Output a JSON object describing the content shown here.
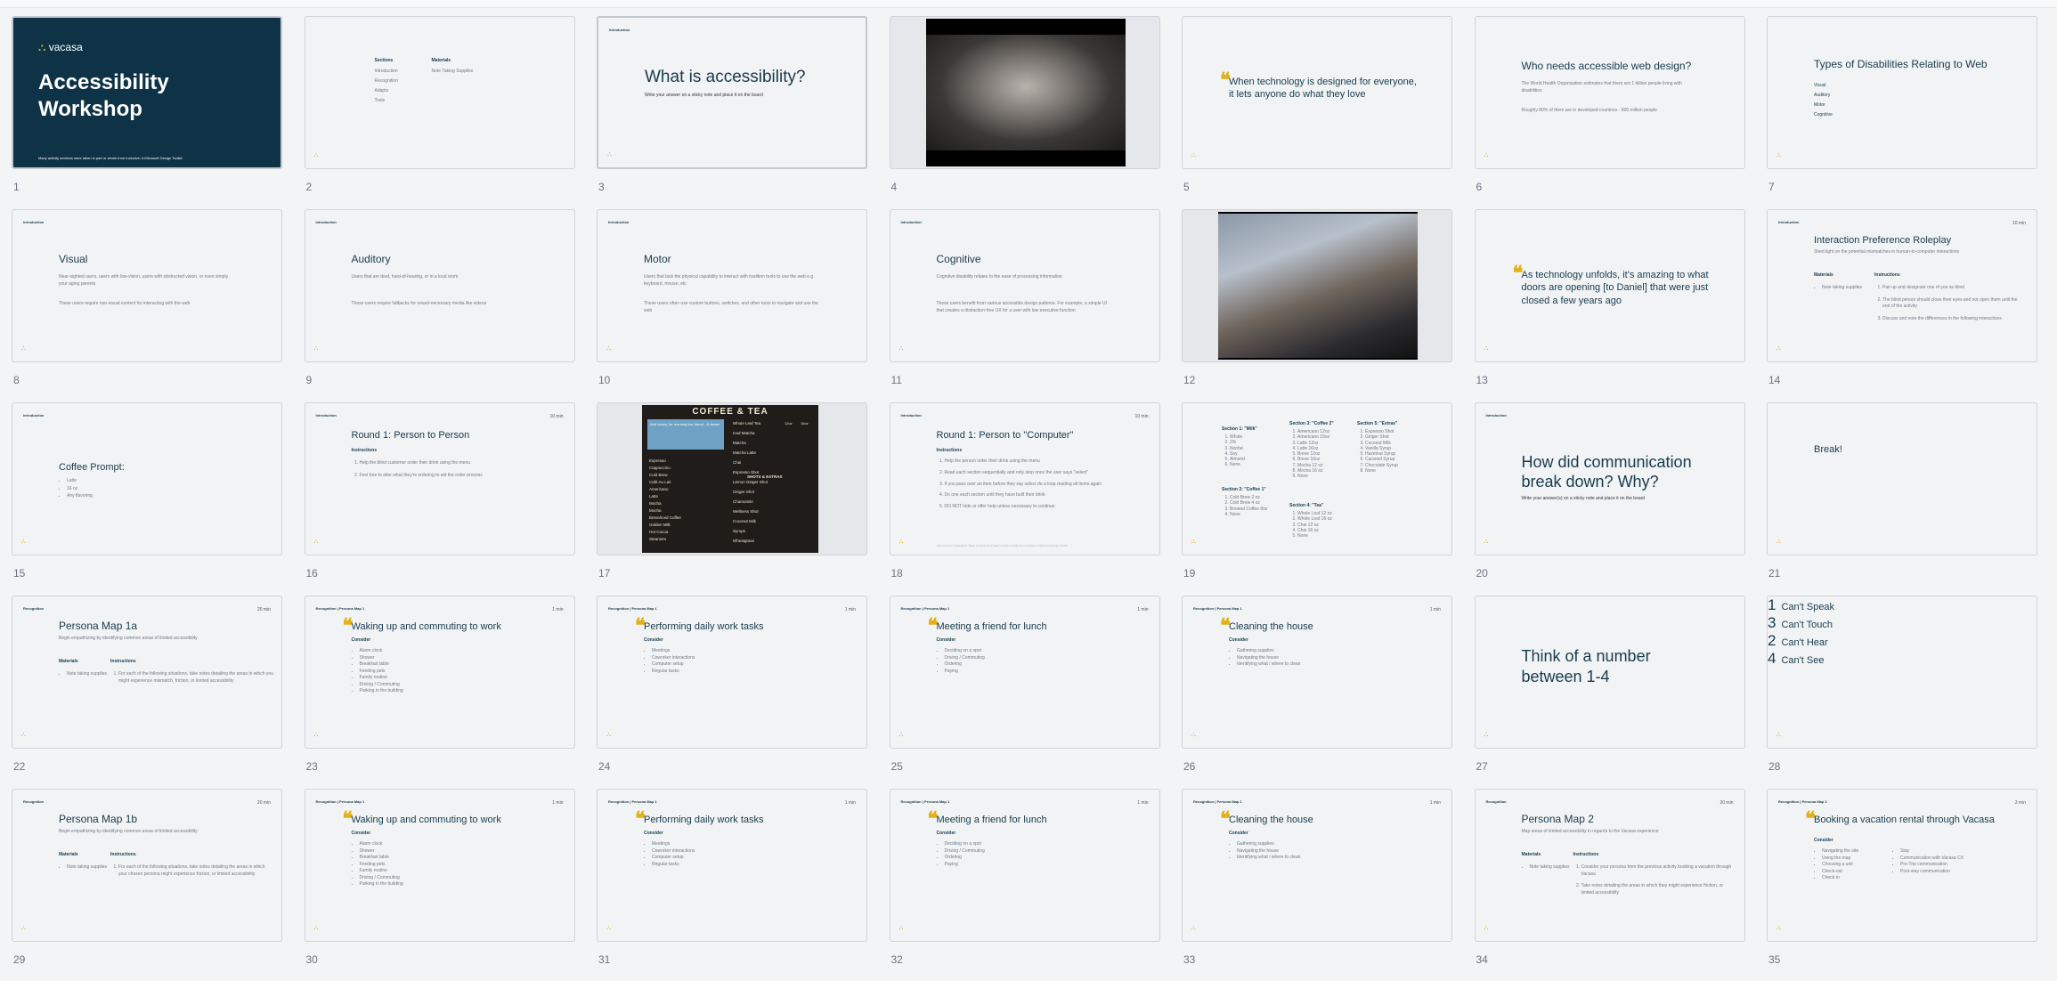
{
  "slides": [
    {
      "num": "1",
      "tag": "",
      "title": "",
      "kind": "cover",
      "brand": "vacasa",
      "cover_title": "Accessibility Workshop",
      "footer": "Many activity sections were taken in part or whole from Inclusive: A Microsoft Design Toolkit"
    },
    {
      "num": "2",
      "kind": "sections",
      "col1_title": "Sections",
      "col1": [
        "Introduction",
        "Recognition",
        "Adapts",
        "Tools"
      ],
      "col2_title": "Materials",
      "col2": [
        "Note Taking Supplies"
      ]
    },
    {
      "num": "3",
      "kind": "title-sub",
      "tag": "Introduction",
      "title": "What is accessibility?",
      "sub": "Write your answer on a sticky note and place it on the board"
    },
    {
      "num": "4",
      "kind": "video"
    },
    {
      "num": "5",
      "kind": "quote",
      "quote_text": "When technology is designed for everyone, it lets anyone do what they love"
    },
    {
      "num": "6",
      "kind": "text",
      "title": "Who needs accessible web design?",
      "lines": [
        "The World Health Organization estimates that there are 1 billion people living with disabilities",
        "Roughly 80% of them are in developed countries - 800 million people"
      ]
    },
    {
      "num": "7",
      "kind": "list-title",
      "title": "Types of Disabilities Relating to Web",
      "items": [
        "Visual",
        "Auditory",
        "Motor",
        "Cognitive"
      ]
    },
    {
      "num": "8",
      "kind": "text",
      "tag": "Introduction",
      "title": "Visual",
      "lines": [
        "Near-sighted users, users with low-vision, users with obstructed vision, or even simply your aging parents",
        "These users require non-visual content for interacting with the web"
      ]
    },
    {
      "num": "9",
      "kind": "text",
      "tag": "Introduction",
      "title": "Auditory",
      "lines": [
        "Users that are deaf, hard-of-hearing, or in a loud room",
        "These users require fallbacks for sound-necessary media like videos"
      ]
    },
    {
      "num": "10",
      "kind": "text",
      "tag": "Introduction",
      "title": "Motor",
      "lines": [
        "Users that lack the physical capability to interact with tradition tools to use the web e.g. keyboard, mouse, etc",
        "These users often use custom buttons, switches, and other tools to navigate and use the web"
      ]
    },
    {
      "num": "11",
      "kind": "text",
      "tag": "Introduction",
      "title": "Cognitive",
      "lines": [
        "Cognitive disability relates to the ease of processing information",
        "These users benefit from various accessible design patterns. For example, a simple UI that creates a distraction-free UX for a user with low executive function"
      ]
    },
    {
      "num": "12",
      "kind": "video"
    },
    {
      "num": "13",
      "kind": "quote",
      "quote_text": "As technology unfolds, it's amazing to what doors are opening [to Daniel] that were just closed a few years ago"
    },
    {
      "num": "14",
      "kind": "roleplay",
      "tag": "Introduction",
      "mins": "10 min",
      "title": "Interaction Preference Roleplay",
      "sub": "Shed light on the potential mismatches in human-to-computer interactions",
      "mat_title": "Materials",
      "mat": [
        "Note taking supplies"
      ],
      "ins_title": "Instructions",
      "ins": [
        "Pair up and designate one of you as blind",
        "The blind person should close their eyes and not open them until the end of the activity",
        "Discuss and note the differences in the following interactions"
      ]
    },
    {
      "num": "15",
      "kind": "coffee",
      "tag": "Introduction",
      "title": "Coffee Prompt:",
      "items": [
        "Latte",
        "16 oz",
        "Any flavoring"
      ]
    },
    {
      "num": "16",
      "kind": "round",
      "tag": "Introduction",
      "mins": "10 min",
      "title": "Round 1: Person to Person",
      "ins_title": "Instructions",
      "ins": [
        "Help the blind customer order their drink using the menu",
        "Feel free to alter what they're ordering to aid the order process"
      ]
    },
    {
      "num": "17",
      "kind": "menu",
      "menu_title": "COFFEE & TEA",
      "menu_left": [
        "Espresso",
        "Cappuccino",
        "Cold Brew",
        "Café Au Lait",
        "Americano",
        "Latte",
        "Mocha",
        "Mocha",
        "Breve/Iced Coffee",
        "Golden Milk",
        "Hot Cocoa",
        "Steamers"
      ],
      "menu_right": [
        "Whole Leaf Tea",
        "Iced Matcha",
        "Matcha",
        "Matcha Latte",
        "Chai",
        "Espresso Shot",
        "Lemon Ginger Shot",
        "Ginger Shot",
        "Chamomile",
        "Wellness Shot",
        "Coconut Milk",
        "Syrups",
        "Wheatgrass"
      ],
      "menu_headers": [
        "12oz",
        "16oz"
      ],
      "menu_section": "SHOTS & EXTRAS",
      "menu_note": "Add honey, for morning tea, blend - & steam"
    },
    {
      "num": "18",
      "kind": "round2",
      "tag": "Introduction",
      "mins": "10 min",
      "title": "Round 1: Person to \"Computer\"",
      "ins_title": "Instructions",
      "ins": [
        "Help the person order their drink using the menu",
        "Read each section sequentially and only stop once the user says \"select\"",
        "If you pass over an item before they say select do a loop reading all items again",
        "Do one each section until they have built their drink",
        "DO NOT hide or offer help unless necessary to continue"
      ],
      "footer": "This round for explanation: Many sections were taken in part or whole from Inclusive: A Microsoft Design Toolkit"
    },
    {
      "num": "19",
      "kind": "sections-menu",
      "s1_title": "Section 1: \"Milk\"",
      "s1": [
        "Whole",
        "2%",
        "Nonfat",
        "Soy",
        "Almond",
        "None"
      ],
      "s2_title": "Section 2: \"Coffee 1\"",
      "s2": [
        "Cold Brew 2 oz",
        "Cold Brew 4 oz",
        "Brewed Coffee 8oz",
        "None"
      ],
      "s3_title": "Section 3: \"Coffee 2\"",
      "s3": [
        "Americano 12oz",
        "Americano 16oz",
        "Latte 12oz",
        "Latte 16oz",
        "Breve 12oz",
        "Breve 16oz",
        "Mocha 12 oz",
        "Mocha 16 oz",
        "None"
      ],
      "s4_title": "Section 4: \"Tea\"",
      "s4": [
        "Whole Leaf 12 oz",
        "Whole Leaf 16 oz",
        "Chai 12 oz",
        "Chai 16 oz",
        "None"
      ],
      "s5_title": "Section 5: \"Extras\"",
      "s5": [
        "Espresso Shot",
        "Ginger Shot",
        "Coconut Milk",
        "Vanilla Syrup",
        "Hazelnut Syrup",
        "Caramel Syrup",
        "Chocolate Syrup",
        "None"
      ]
    },
    {
      "num": "20",
      "kind": "title-sub2",
      "tag": "Introduction",
      "title": "How did communication break down? Why?",
      "sub": "Write your answer(s) on a sticky note and place it on the board"
    },
    {
      "num": "21",
      "kind": "break",
      "title": "Break!"
    },
    {
      "num": "22",
      "kind": "persona",
      "tag": "Recognition",
      "mins": "20 min",
      "title": "Persona Map 1a",
      "sub": "Begin empathizing by identifying common areas of limited accessibility",
      "mat_title": "Materials",
      "mat": [
        "Note taking supplies"
      ],
      "ins_title": "Instructions",
      "ins": [
        "For each of the following situations, take notes detailing the areas in which you might experience mismatch, friction, or limited accessibility"
      ]
    },
    {
      "num": "23",
      "kind": "scenario",
      "tag": "Recognition | Persona Map 1",
      "mins": "1 min",
      "title": "Waking up and commuting to work",
      "consider": "Consider",
      "items": [
        "Alarm clock",
        "Shower",
        "Breakfast table",
        "Feeding pets",
        "Family routine",
        "Driving / Commuting",
        "Parking in the building"
      ]
    },
    {
      "num": "24",
      "kind": "scenario",
      "tag": "Recognition | Persona Map 1",
      "mins": "1 min",
      "title": "Performing daily work tasks",
      "consider": "Consider",
      "items": [
        "Meetings",
        "Coworker interactions",
        "Computer setup",
        "Regular tasks"
      ]
    },
    {
      "num": "25",
      "kind": "scenario",
      "tag": "Recognition | Persona Map 1",
      "mins": "1 min",
      "title": "Meeting a friend for lunch",
      "consider": "Consider",
      "items": [
        "Deciding on a spot",
        "Driving / Commuting",
        "Ordering",
        "Paying"
      ]
    },
    {
      "num": "26",
      "kind": "scenario",
      "tag": "Recognition | Persona Map 1",
      "mins": "1 min",
      "title": "Cleaning the house",
      "consider": "Consider",
      "items": [
        "Gathering supplies",
        "Navigating the house",
        "Identifying what / where to clean"
      ]
    },
    {
      "num": "27",
      "kind": "think",
      "title": "Think of a number between 1-4"
    },
    {
      "num": "28",
      "kind": "numbers",
      "items": [
        {
          "n": "1",
          "t": "Can't Speak"
        },
        {
          "n": "3",
          "t": "Can't Touch"
        },
        {
          "n": "2",
          "t": "Can't Hear"
        },
        {
          "n": "4",
          "t": "Can't See"
        }
      ]
    },
    {
      "num": "29",
      "kind": "persona",
      "tag": "Recognition",
      "mins": "20 min",
      "title": "Persona Map 1b",
      "sub": "Begin empathizing by identifying common areas of limited accessibility",
      "mat_title": "Materials",
      "mat": [
        "Note taking supplies"
      ],
      "ins_title": "Instructions",
      "ins": [
        "For each of the following situations, take notes detailing the areas in which your chosen persona might experience friction, or limited accessibility"
      ]
    },
    {
      "num": "30",
      "kind": "scenario",
      "tag": "Recognition | Persona Map 1",
      "mins": "1 min",
      "title": "Waking up and commuting to work",
      "consider": "Consider",
      "items": [
        "Alarm clock",
        "Shower",
        "Breakfast table",
        "Feeding pets",
        "Family routine",
        "Driving / Commuting",
        "Parking in the building"
      ]
    },
    {
      "num": "31",
      "kind": "scenario",
      "tag": "Recognition | Persona Map 1",
      "mins": "1 min",
      "title": "Performing daily work tasks",
      "consider": "Consider",
      "items": [
        "Meetings",
        "Coworker interactions",
        "Computer setup",
        "Regular tasks"
      ]
    },
    {
      "num": "32",
      "kind": "scenario",
      "tag": "Recognition | Persona Map 1",
      "mins": "1 min",
      "title": "Meeting a friend for lunch",
      "consider": "Consider",
      "items": [
        "Deciding on a spot",
        "Driving / Commuting",
        "Ordering",
        "Paying"
      ]
    },
    {
      "num": "33",
      "kind": "scenario",
      "tag": "Recognition | Persona Map 1",
      "mins": "1 min",
      "title": "Cleaning the house",
      "consider": "Consider",
      "items": [
        "Gathering supplies",
        "Navigating the house",
        "Identifying what / where to clean"
      ]
    },
    {
      "num": "34",
      "kind": "persona",
      "tag": "Recognition",
      "mins": "20 min",
      "title": "Persona Map 2",
      "sub": "Map areas of limited accessibility in regards to the Vacasa experience",
      "mat_title": "Materials",
      "mat": [
        "Note taking supplies"
      ],
      "ins_title": "Instructions",
      "ins": [
        "Consider your persona from the previous activity booking a vacation through Vacasa",
        "Take notes detailing the areas in which they might experience friction, or limited accessibility"
      ]
    },
    {
      "num": "35",
      "kind": "scenario2",
      "tag": "Recognition | Persona Map 2",
      "mins": "3 min",
      "title": "Booking a vacation rental through Vacasa",
      "consider": "Consider",
      "items": [
        "Navigating the site",
        "Using the map",
        "Choosing a unit",
        "Check-out",
        "Check-in"
      ],
      "items2": [
        "Stay",
        "Communication with Vacasa CX",
        "Pre-Trip communication",
        "Post-stay communication"
      ]
    }
  ],
  "colors": {
    "accent": "#e3b21a",
    "navy": "#0e3246",
    "title": "#173b4d"
  }
}
